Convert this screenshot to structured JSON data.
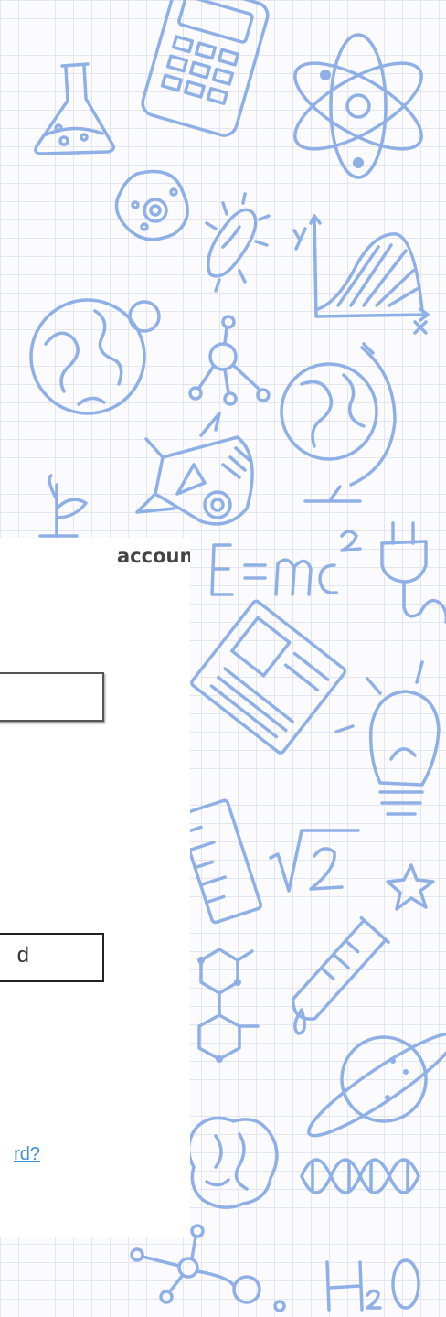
{
  "login_card": {
    "title": "account",
    "username_field": {
      "value": ""
    },
    "password_field": {
      "placeholder": "d"
    },
    "forgot_link": "rd?"
  },
  "colors": {
    "doodle_ink": "#8fb0e6",
    "link": "#3b8fd4",
    "grid": "#e3e6ee"
  },
  "doodles": {
    "formula_text": "E = mc²",
    "sqrt_text": "√2",
    "water_text": "H₂O",
    "graph_axis_y": "y",
    "graph_axis_x": "x",
    "icons": [
      "flask-icon",
      "calculator-icon",
      "atom-icon",
      "bacteria-icon",
      "microbe-icon",
      "bell-curve-graph-icon",
      "earth-icon",
      "moon-icon",
      "molecule-icon",
      "globe-icon",
      "rocket-icon",
      "plant-icon",
      "plug-icon",
      "book-icon",
      "lightbulb-icon",
      "ruler-icon",
      "star-icon",
      "hexagon-molecule-icon",
      "test-tube-icon",
      "planet-icon",
      "brain-icon",
      "dna-icon",
      "molecule-chain-icon"
    ]
  }
}
